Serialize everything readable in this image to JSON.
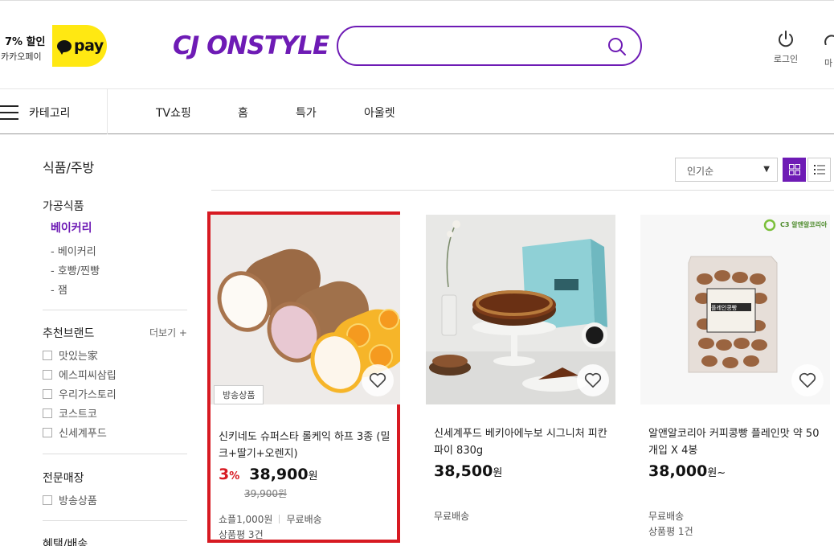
{
  "header": {
    "promo_percent": "7% 할인",
    "promo_label": "카카오페이",
    "kakao_pay": "pay",
    "logo": "CJ ONSTYLE",
    "search_value": "",
    "login_label": "로그인",
    "mypage_label": "마"
  },
  "nav": {
    "category": "카테고리",
    "items": [
      "TV쇼핑",
      "홈",
      "특가",
      "아울렛"
    ]
  },
  "sidebar": {
    "title": "식품/주방",
    "group": "가공식품",
    "active": "베이커리",
    "subs": [
      "- 베이커리",
      "- 호빵/찐빵",
      "- 잼"
    ],
    "brand_title": "추천브랜드",
    "brand_more": "더보기 +",
    "brands": [
      "맛있는家",
      "에스피씨삼립",
      "우리가스토리",
      "코스트코",
      "신세계푸드"
    ],
    "special_title": "전문매장",
    "special_items": [
      "방송상품"
    ],
    "benefit_title": "혜택/배송"
  },
  "toolbar": {
    "sort_value": "인기순"
  },
  "products": [
    {
      "name": "신키네도 슈퍼스타 롤케익 하프 3종 (밀크+딸기+오렌지)",
      "discount": "3",
      "discount_unit": "%",
      "price": "38,900",
      "won": "원",
      "original_price": "39,900원",
      "badge": "방송상품",
      "points": "쇼플1,000원",
      "shipping": "무료배송",
      "reviews": "상품평 3건"
    },
    {
      "name": "신세계푸드 베키아에누보 시그니처 피칸파이 830g",
      "price": "38,500",
      "won": "원",
      "shipping": "무료배송"
    },
    {
      "name": "알앤알코리아 커피콩빵 플레인맛 약 50개입 X 4봉",
      "price": "38,000",
      "won": "원~",
      "shipping": "무료배송",
      "reviews": "상품평 1건",
      "brand_logo": "C3 알앤알코리아",
      "package_label": "플레인콩빵"
    }
  ],
  "colors": {
    "brand": "#6e1bb5",
    "discount": "#d71a22",
    "kakao": "#ffe812"
  }
}
